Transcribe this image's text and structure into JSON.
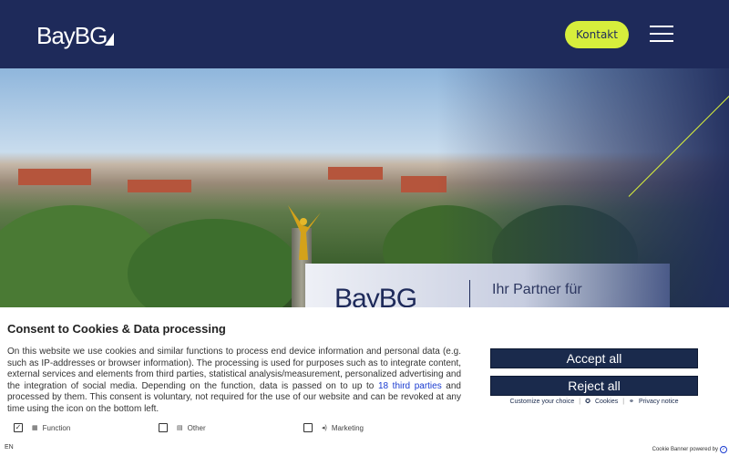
{
  "header": {
    "logo_text": "BayBG",
    "contact_label": "Kontakt"
  },
  "hero": {
    "card_logo": "BayBG",
    "card_text": "Ihr Partner für"
  },
  "consent": {
    "title": "Consent to Cookies & Data processing",
    "text_before_link": "On this website we use cookies and similar functions to process end device information and personal data (e.g. such as IP-addresses or browser information). The processing is used for purposes such as to integrate content, external services and elements from third parties, statistical analysis/measurement, personalized advertising and the integration of social media. Depending on the function, data is passed on to up to ",
    "link_text": "18 third parties",
    "text_after_link": " and processed by them. This consent is voluntary, not required for the use of our website and can be revoked at any time using the icon on the bottom left.",
    "accept_label": "Accept all",
    "reject_label": "Reject all",
    "links": {
      "customize": "Customize your choice",
      "cookies": "Cookies",
      "privacy": "Privacy notice"
    },
    "options": [
      {
        "label": "Function",
        "checked": true
      },
      {
        "label": "Other",
        "checked": false
      },
      {
        "label": "Marketing",
        "checked": false
      }
    ],
    "language": "EN",
    "powered_by": "Cookie Banner powered by"
  },
  "colors": {
    "navy": "#1e2a5a",
    "accent": "#d7ee3c",
    "button": "#1a2a4c",
    "link": "#1a3bd0"
  }
}
